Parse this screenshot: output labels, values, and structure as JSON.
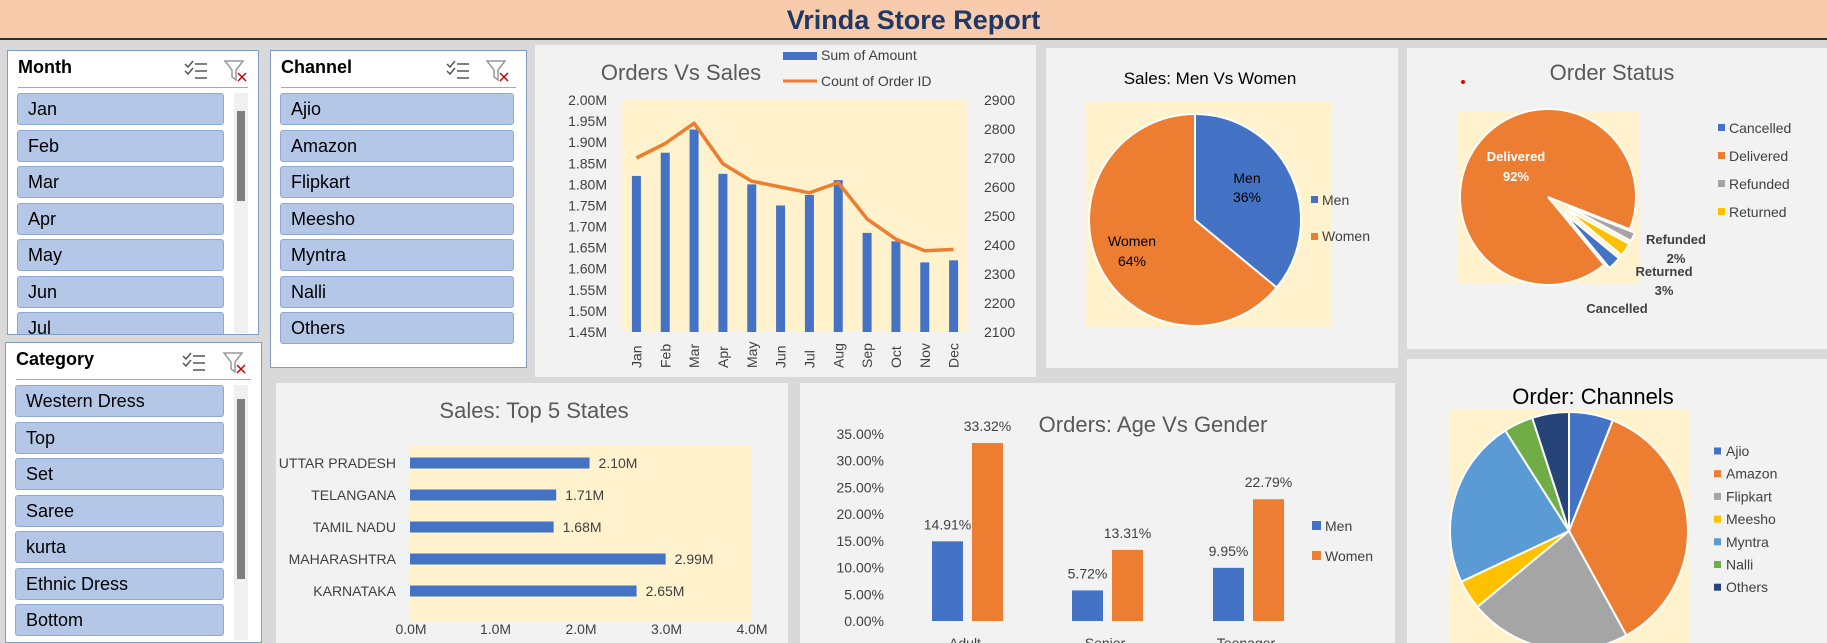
{
  "title": "Vrinda Store Report",
  "slicers": {
    "month": {
      "title": "Month",
      "items": [
        "Jan",
        "Feb",
        "Mar",
        "Apr",
        "May",
        "Jun"
      ],
      "partial": "Jul"
    },
    "channel": {
      "title": "Channel",
      "items": [
        "Ajio",
        "Amazon",
        "Flipkart",
        "Meesho",
        "Myntra",
        "Nalli",
        "Others"
      ]
    },
    "category": {
      "title": "Category",
      "items": [
        "Western Dress",
        "Top",
        "Set",
        "Saree",
        "kurta",
        "Ethnic Dress",
        "Bottom"
      ]
    }
  },
  "colors": {
    "blue": "#4472c4",
    "orange": "#ed7d31",
    "gray": "#a5a5a5",
    "yellow": "#ffc000",
    "lightblue": "#5b9bd5",
    "green": "#70ad47",
    "navy": "#264478",
    "plot_bg": "#fff2cc"
  },
  "chart_data": [
    {
      "type": "bar",
      "title": "Orders Vs Sales",
      "categories": [
        "Jan",
        "Feb",
        "Mar",
        "Apr",
        "May",
        "Jun",
        "Jul",
        "Aug",
        "Sep",
        "Oct",
        "Nov",
        "Dec"
      ],
      "series": [
        {
          "name": "Sum of Amount",
          "axis": "left",
          "values": [
            1820000,
            1875000,
            1930000,
            1825000,
            1800000,
            1750000,
            1775000,
            1810000,
            1685000,
            1665000,
            1615000,
            1620000
          ]
        },
        {
          "name": "Count of Order ID",
          "axis": "right",
          "type": "line",
          "values": [
            2700,
            2750,
            2820,
            2680,
            2620,
            2600,
            2580,
            2615,
            2490,
            2420,
            2380,
            2385
          ]
        }
      ],
      "y_left_ticks": [
        "1.45M",
        "1.50M",
        "1.55M",
        "1.60M",
        "1.65M",
        "1.70M",
        "1.75M",
        "1.80M",
        "1.85M",
        "1.90M",
        "1.95M",
        "2.00M"
      ],
      "ylim_left": [
        1450000,
        2000000
      ],
      "y_right_ticks": [
        "2100",
        "2200",
        "2300",
        "2400",
        "2500",
        "2600",
        "2700",
        "2800",
        "2900"
      ],
      "ylim_right": [
        2100,
        2900
      ]
    },
    {
      "type": "pie",
      "title": "Sales: Men Vs Women",
      "slices": [
        {
          "name": "Men",
          "value": 36,
          "label": "36%"
        },
        {
          "name": "Women",
          "value": 64,
          "label": "64%"
        }
      ]
    },
    {
      "type": "pie",
      "title": "Order Status",
      "slices": [
        {
          "name": "Cancelled",
          "value": 3,
          "label": ""
        },
        {
          "name": "Delivered",
          "value": 92,
          "label": "92%"
        },
        {
          "name": "Refunded",
          "value": 2,
          "label": "2%"
        },
        {
          "name": "Returned",
          "value": 3,
          "label": "3%"
        }
      ]
    },
    {
      "type": "bar",
      "orientation": "horizontal",
      "title": "Sales: Top 5 States",
      "categories": [
        "UTTAR PRADESH",
        "TELANGANA",
        "TAMIL NADU",
        "MAHARASHTRA",
        "KARNATAKA"
      ],
      "values": [
        2.1,
        1.71,
        1.68,
        2.99,
        2.65
      ],
      "labels": [
        "2.10M",
        "1.71M",
        "1.68M",
        "2.99M",
        "2.65M"
      ],
      "x_ticks": [
        "0.0M",
        "1.0M",
        "2.0M",
        "3.0M",
        "4.0M"
      ],
      "xlim": [
        0,
        4
      ]
    },
    {
      "type": "bar",
      "title": "Orders: Age Vs Gender",
      "categories": [
        "Adult",
        "Senior",
        "Teenager"
      ],
      "series": [
        {
          "name": "Men",
          "values": [
            14.91,
            5.72,
            9.95
          ],
          "labels": [
            "14.91%",
            "5.72%",
            "9.95%"
          ]
        },
        {
          "name": "Women",
          "values": [
            33.32,
            13.31,
            22.79
          ],
          "labels": [
            "33.32%",
            "13.31%",
            "22.79%"
          ]
        }
      ],
      "y_ticks": [
        "0.00%",
        "5.00%",
        "10.00%",
        "15.00%",
        "20.00%",
        "25.00%",
        "30.00%",
        "35.00%"
      ],
      "ylim": [
        0,
        35
      ]
    },
    {
      "type": "pie",
      "title": "Order: Channels",
      "slices": [
        {
          "name": "Ajio",
          "value": 6
        },
        {
          "name": "Amazon",
          "value": 36
        },
        {
          "name": "Flipkart",
          "value": 22
        },
        {
          "name": "Meesho",
          "value": 4
        },
        {
          "name": "Myntra",
          "value": 23
        },
        {
          "name": "Nalli",
          "value": 4
        },
        {
          "name": "Others",
          "value": 5
        }
      ]
    }
  ]
}
